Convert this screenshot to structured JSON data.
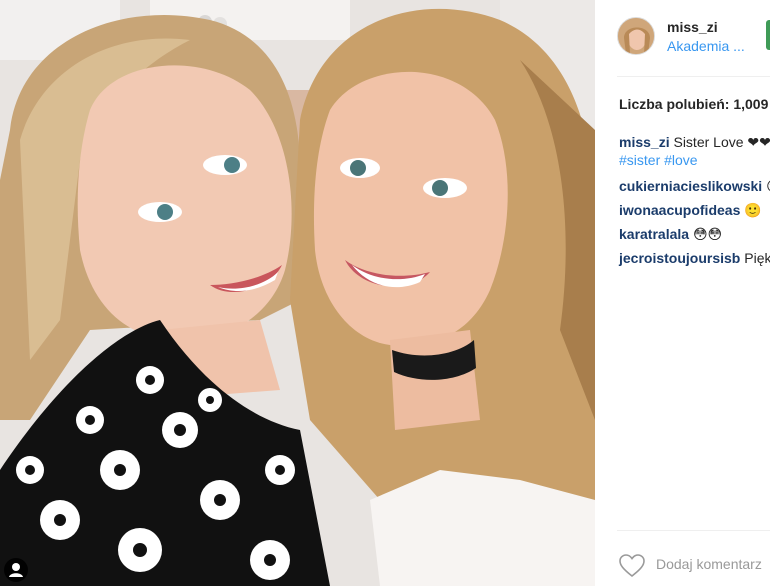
{
  "post": {
    "username": "miss_zi",
    "location": "Akademia ...",
    "likes_text": "Liczba polubień: 1,009",
    "caption": {
      "author": "miss_zi",
      "text": " Sister Love ❤❤",
      "hashtags": "#sister #love"
    },
    "comments": [
      {
        "author": "cukierniacieslikowski",
        "text": " 😊"
      },
      {
        "author": "iwonaacupofideas",
        "text": " 🙂"
      },
      {
        "author": "karatralala",
        "text": " 😳😳"
      },
      {
        "author": "jecroistoujoursisb",
        "text": " Pięk"
      }
    ],
    "add_comment_placeholder": "Dodaj komentarz"
  },
  "colors": {
    "link_blue": "#3897f0",
    "username_dark": "#1b3c6b",
    "placeholder_gray": "#999999",
    "follow_green": "#3f9b57"
  },
  "icons": {
    "like": "heart-outline-icon",
    "user_tag": "person-tag-icon"
  }
}
